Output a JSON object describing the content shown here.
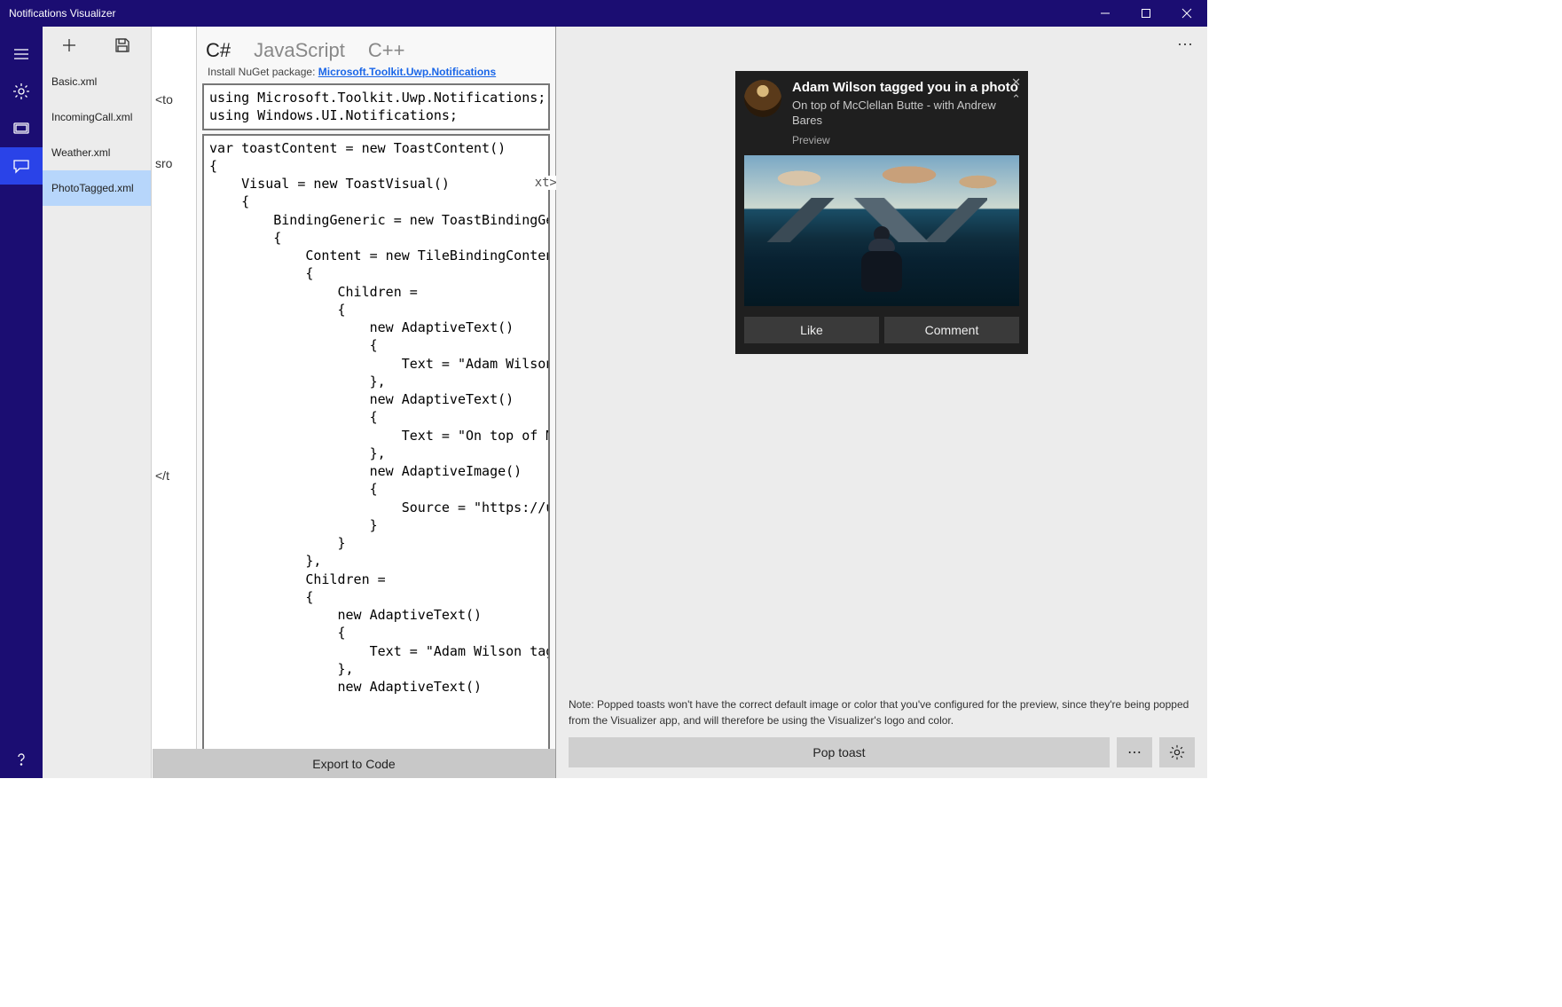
{
  "window": {
    "title": "Notifications Visualizer"
  },
  "navrail": [
    {
      "name": "hamburger-icon"
    },
    {
      "name": "gear-icon"
    },
    {
      "name": "display-icon"
    },
    {
      "name": "chat-icon",
      "active": true
    },
    {
      "name": "help-icon",
      "bottom": true
    }
  ],
  "file_toolbar": {
    "new": "+",
    "save": "save"
  },
  "files": [
    {
      "label": "Basic.xml",
      "selected": false
    },
    {
      "label": "IncomingCall.xml",
      "selected": false
    },
    {
      "label": "Weather.xml",
      "selected": false
    },
    {
      "label": "PhotoTagged.xml",
      "selected": true
    }
  ],
  "xml_fragments": [
    "<to",
    "sro",
    "xt>",
    "</t"
  ],
  "code_panel": {
    "tabs": [
      {
        "label": "C#",
        "active": true
      },
      {
        "label": "JavaScript",
        "active": false
      },
      {
        "label": "C++",
        "active": false
      }
    ],
    "nuget_prefix": "Install NuGet package: ",
    "nuget_link": "Microsoft.Toolkit.Uwp.Notifications",
    "usings": "using Microsoft.Toolkit.Uwp.Notifications;\nusing Windows.UI.Notifications;",
    "code": "var toastContent = new ToastContent()\n{\n    Visual = new ToastVisual()\n    {\n        BindingGeneric = new ToastBindingGeneric()\n        {\n            Content = new TileBindingContentAdaptive\n            {\n                Children =\n                {\n                    new AdaptiveText()\n                    {\n                        Text = \"Adam Wilson tagged \n                    },\n                    new AdaptiveText()\n                    {\n                        Text = \"On top of McClellan\n                    },\n                    new AdaptiveImage()\n                    {\n                        Source = \"https://unsplash.\n                    }\n                }\n            },\n            Children =\n            {\n                new AdaptiveText()\n                {\n                    Text = \"Adam Wilson tagged you \n                },\n                new AdaptiveText()",
    "export_label": "Export to Code"
  },
  "ellipsis": "⋯",
  "toast": {
    "title": "Adam Wilson tagged you in a photo",
    "subtitle": "On top of McClellan Butte - with Andrew Bares",
    "attribution": "Preview",
    "close": "✕",
    "chevron": "⌃",
    "actions": {
      "like": "Like",
      "comment": "Comment"
    }
  },
  "note": "Note: Popped toasts won't have the correct default image or color that you've configured for the preview, since they're being popped from the Visualizer app, and will therefore be using the Visualizer's logo and color.",
  "bottom": {
    "pop": "Pop toast",
    "more": "⋯"
  }
}
